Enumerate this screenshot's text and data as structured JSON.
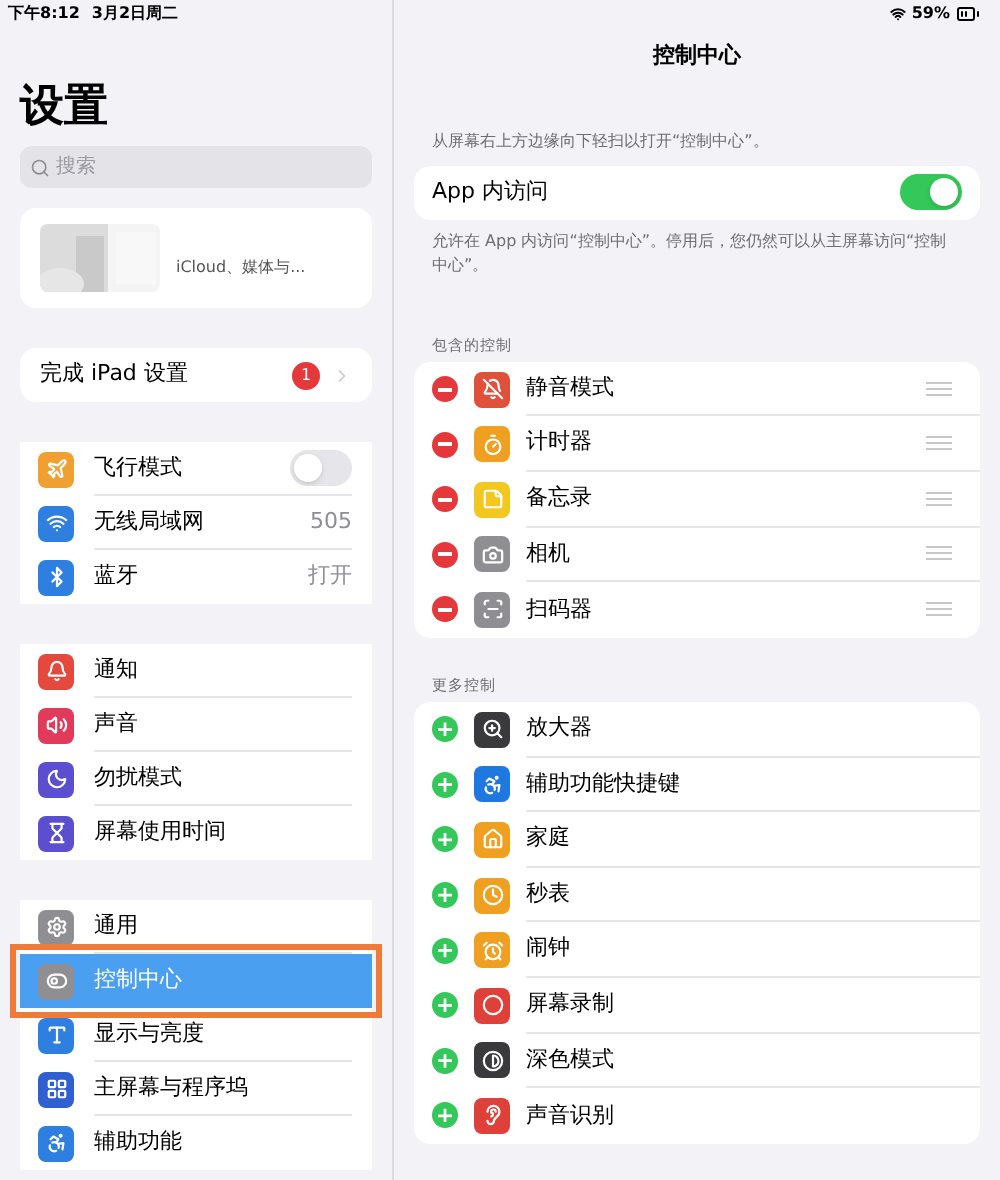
{
  "status_bar": {
    "time": "下午8:12",
    "date": "3月2日周二",
    "battery": "59%"
  },
  "sidebar": {
    "title": "设置",
    "search": {
      "placeholder": "搜索"
    },
    "profile": {
      "subtitle": "iCloud、媒体与..."
    },
    "setup": {
      "label": "完成 iPad 设置",
      "badge": "1"
    },
    "groups": [
      [
        {
          "label": "飞行模式",
          "kind": "toggle",
          "on": false,
          "color": "#f0a030",
          "selected": false
        },
        {
          "label": "无线局域网",
          "kind": "value",
          "value": "505",
          "color": "#2f7fe0",
          "selected": false
        },
        {
          "label": "蓝牙",
          "kind": "value",
          "value": "打开",
          "color": "#2f7fe0",
          "selected": false
        }
      ],
      [
        {
          "label": "通知",
          "kind": "plain",
          "color": "#e5493e",
          "selected": false
        },
        {
          "label": "声音",
          "kind": "plain",
          "color": "#e23a5a",
          "selected": false
        },
        {
          "label": "勿扰模式",
          "kind": "plain",
          "color": "#5b4fd0",
          "selected": false
        },
        {
          "label": "屏幕使用时间",
          "kind": "plain",
          "color": "#5b4fd0",
          "selected": false
        }
      ],
      [
        {
          "label": "通用",
          "kind": "plain",
          "color": "#8e8e93",
          "selected": false
        },
        {
          "label": "控制中心",
          "kind": "plain",
          "color": "#8e8e93",
          "selected": true
        },
        {
          "label": "显示与亮度",
          "kind": "plain",
          "color": "#2f7fe0",
          "selected": false
        },
        {
          "label": "主屏幕与程序坞",
          "kind": "plain",
          "color": "#2f5fd0",
          "selected": false
        },
        {
          "label": "辅助功能",
          "kind": "plain",
          "color": "#2f7fe0",
          "selected": false
        }
      ]
    ]
  },
  "detail": {
    "title": "控制中心",
    "intro": "从屏幕右上方边缘向下轻扫以打开“控制中心”。",
    "app_access": {
      "label": "App 内访问",
      "on": true
    },
    "note": "允许在 App 内访问“控制中心”。停用后，您仍然可以从主屏幕访问“控制中心”。",
    "included": {
      "header": "包含的控制",
      "items": [
        {
          "label": "静音模式",
          "color": "#e0503a"
        },
        {
          "label": "计时器",
          "color": "#f0a020"
        },
        {
          "label": "备忘录",
          "color": "#f2c820"
        },
        {
          "label": "相机",
          "color": "#8e8e93"
        },
        {
          "label": "扫码器",
          "color": "#8e8e93"
        }
      ]
    },
    "more": {
      "header": "更多控制",
      "items": [
        {
          "label": "放大器",
          "color": "#3a3a3c"
        },
        {
          "label": "辅助功能快捷键",
          "color": "#1f78e0"
        },
        {
          "label": "家庭",
          "color": "#f0a020"
        },
        {
          "label": "秒表",
          "color": "#f0a020"
        },
        {
          "label": "闹钟",
          "color": "#f0a020"
        },
        {
          "label": "屏幕录制",
          "color": "#e0403a"
        },
        {
          "label": "深色模式",
          "color": "#3a3a3c"
        },
        {
          "label": "声音识别",
          "color": "#e0403a"
        }
      ]
    }
  }
}
